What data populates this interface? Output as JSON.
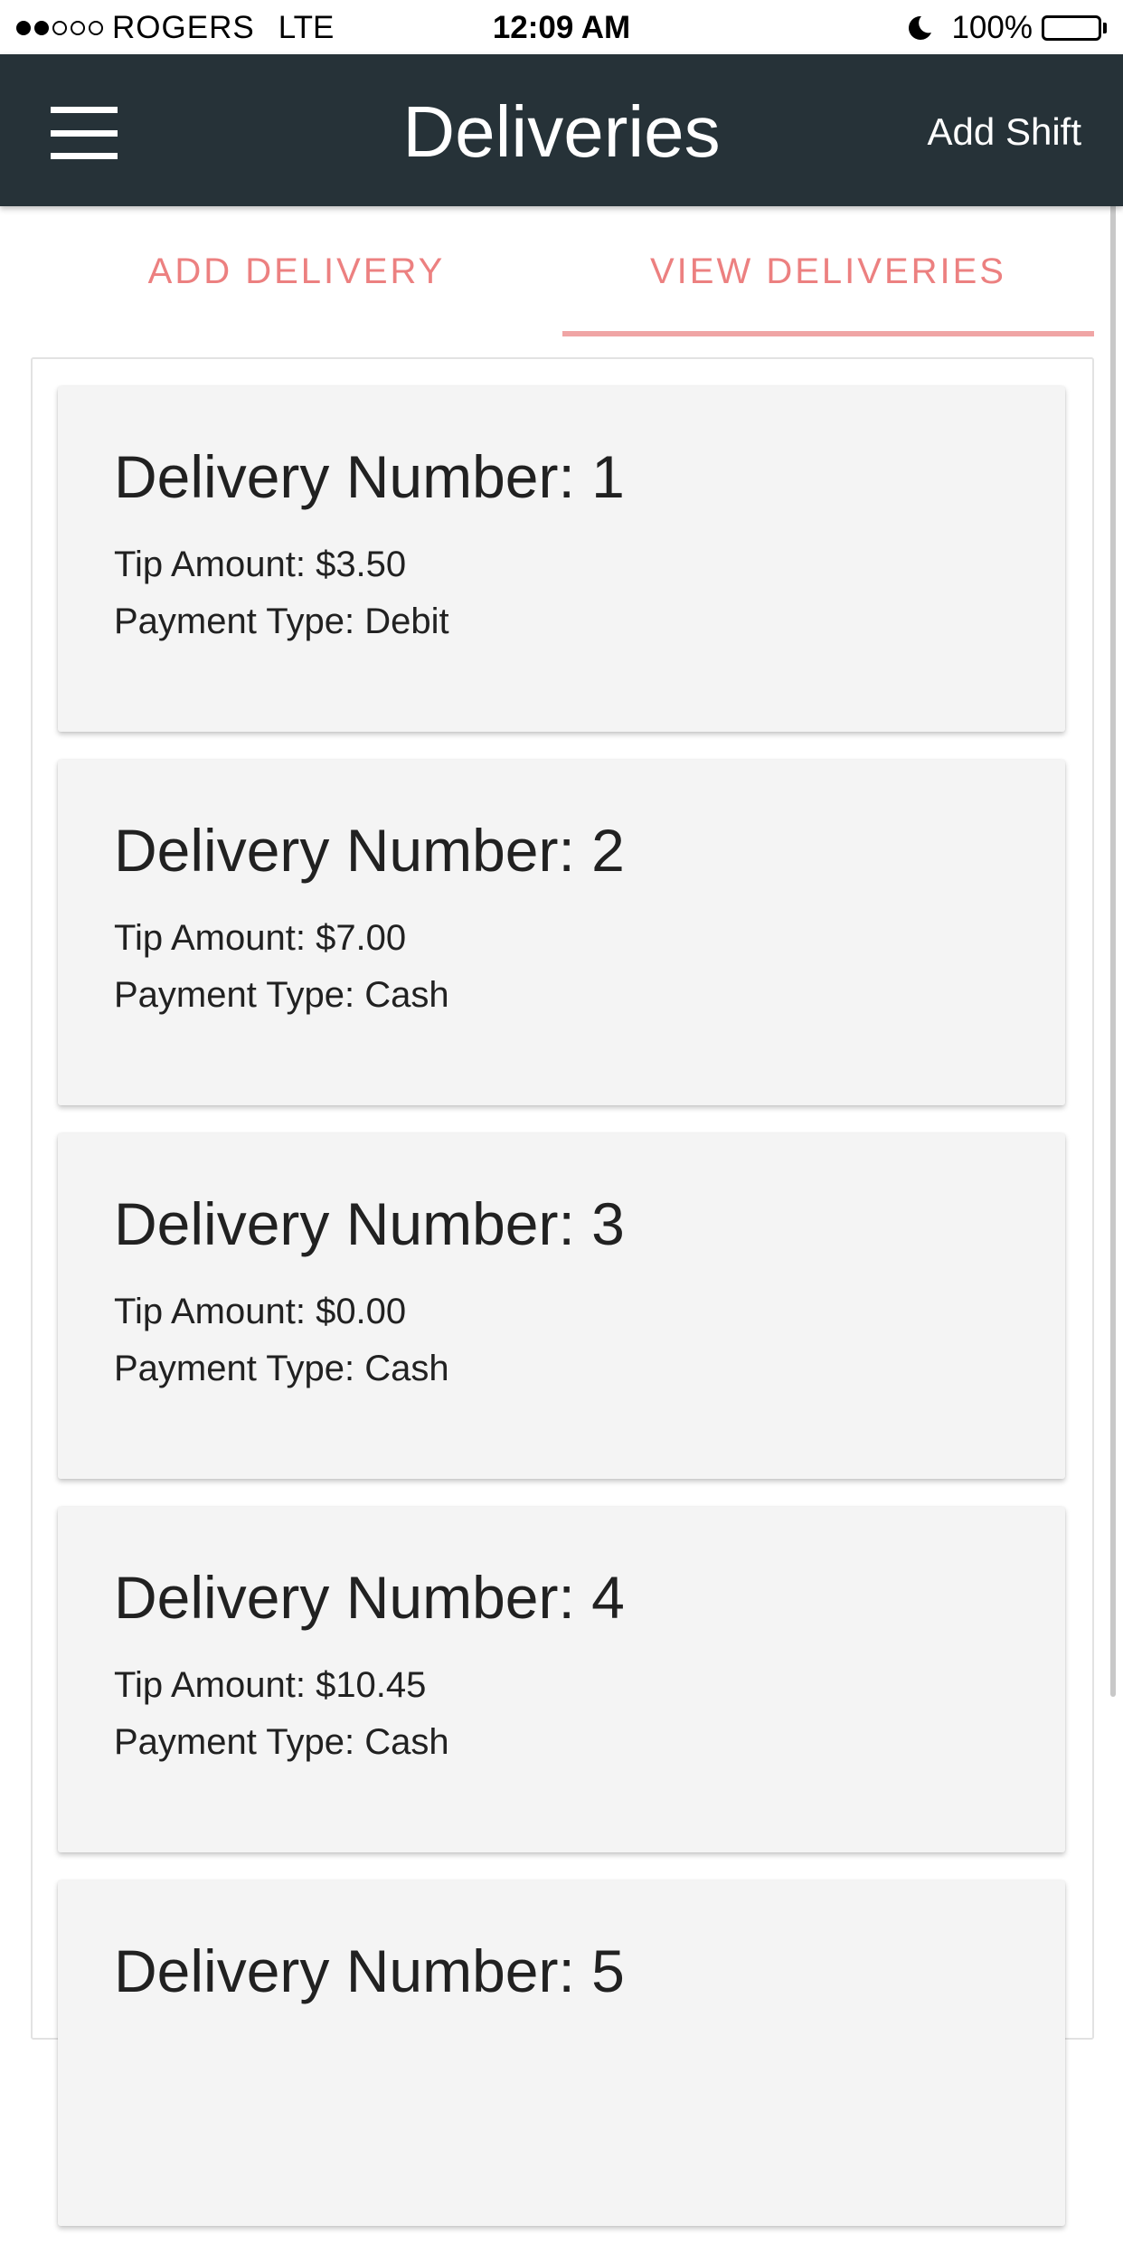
{
  "status_bar": {
    "carrier": "ROGERS",
    "network": "LTE",
    "time": "12:09 AM",
    "battery": "100%",
    "signal_bars_filled": 2,
    "signal_bars_total": 5,
    "icons": [
      "signal-dots-icon",
      "moon-icon",
      "battery-icon"
    ]
  },
  "header": {
    "title": "Deliveries",
    "action_label": "Add Shift",
    "menu_icon": "hamburger-menu-icon",
    "background_color": "#263238"
  },
  "tabs": [
    {
      "label": "ADD DELIVERY",
      "active": false
    },
    {
      "label": "VIEW DELIVERIES",
      "active": true
    }
  ],
  "accent_color": "#ec8080",
  "deliveries": [
    {
      "title": "Delivery Number: 1",
      "tip": "Tip Amount: $3.50",
      "payment": "Payment Type: Debit"
    },
    {
      "title": "Delivery Number: 2",
      "tip": "Tip Amount: $7.00",
      "payment": "Payment Type: Cash"
    },
    {
      "title": "Delivery Number: 3",
      "tip": "Tip Amount: $0.00",
      "payment": "Payment Type: Cash"
    },
    {
      "title": "Delivery Number: 4",
      "tip": "Tip Amount: $10.45",
      "payment": "Payment Type: Cash"
    },
    {
      "title": "Delivery Number: 5"
    }
  ]
}
